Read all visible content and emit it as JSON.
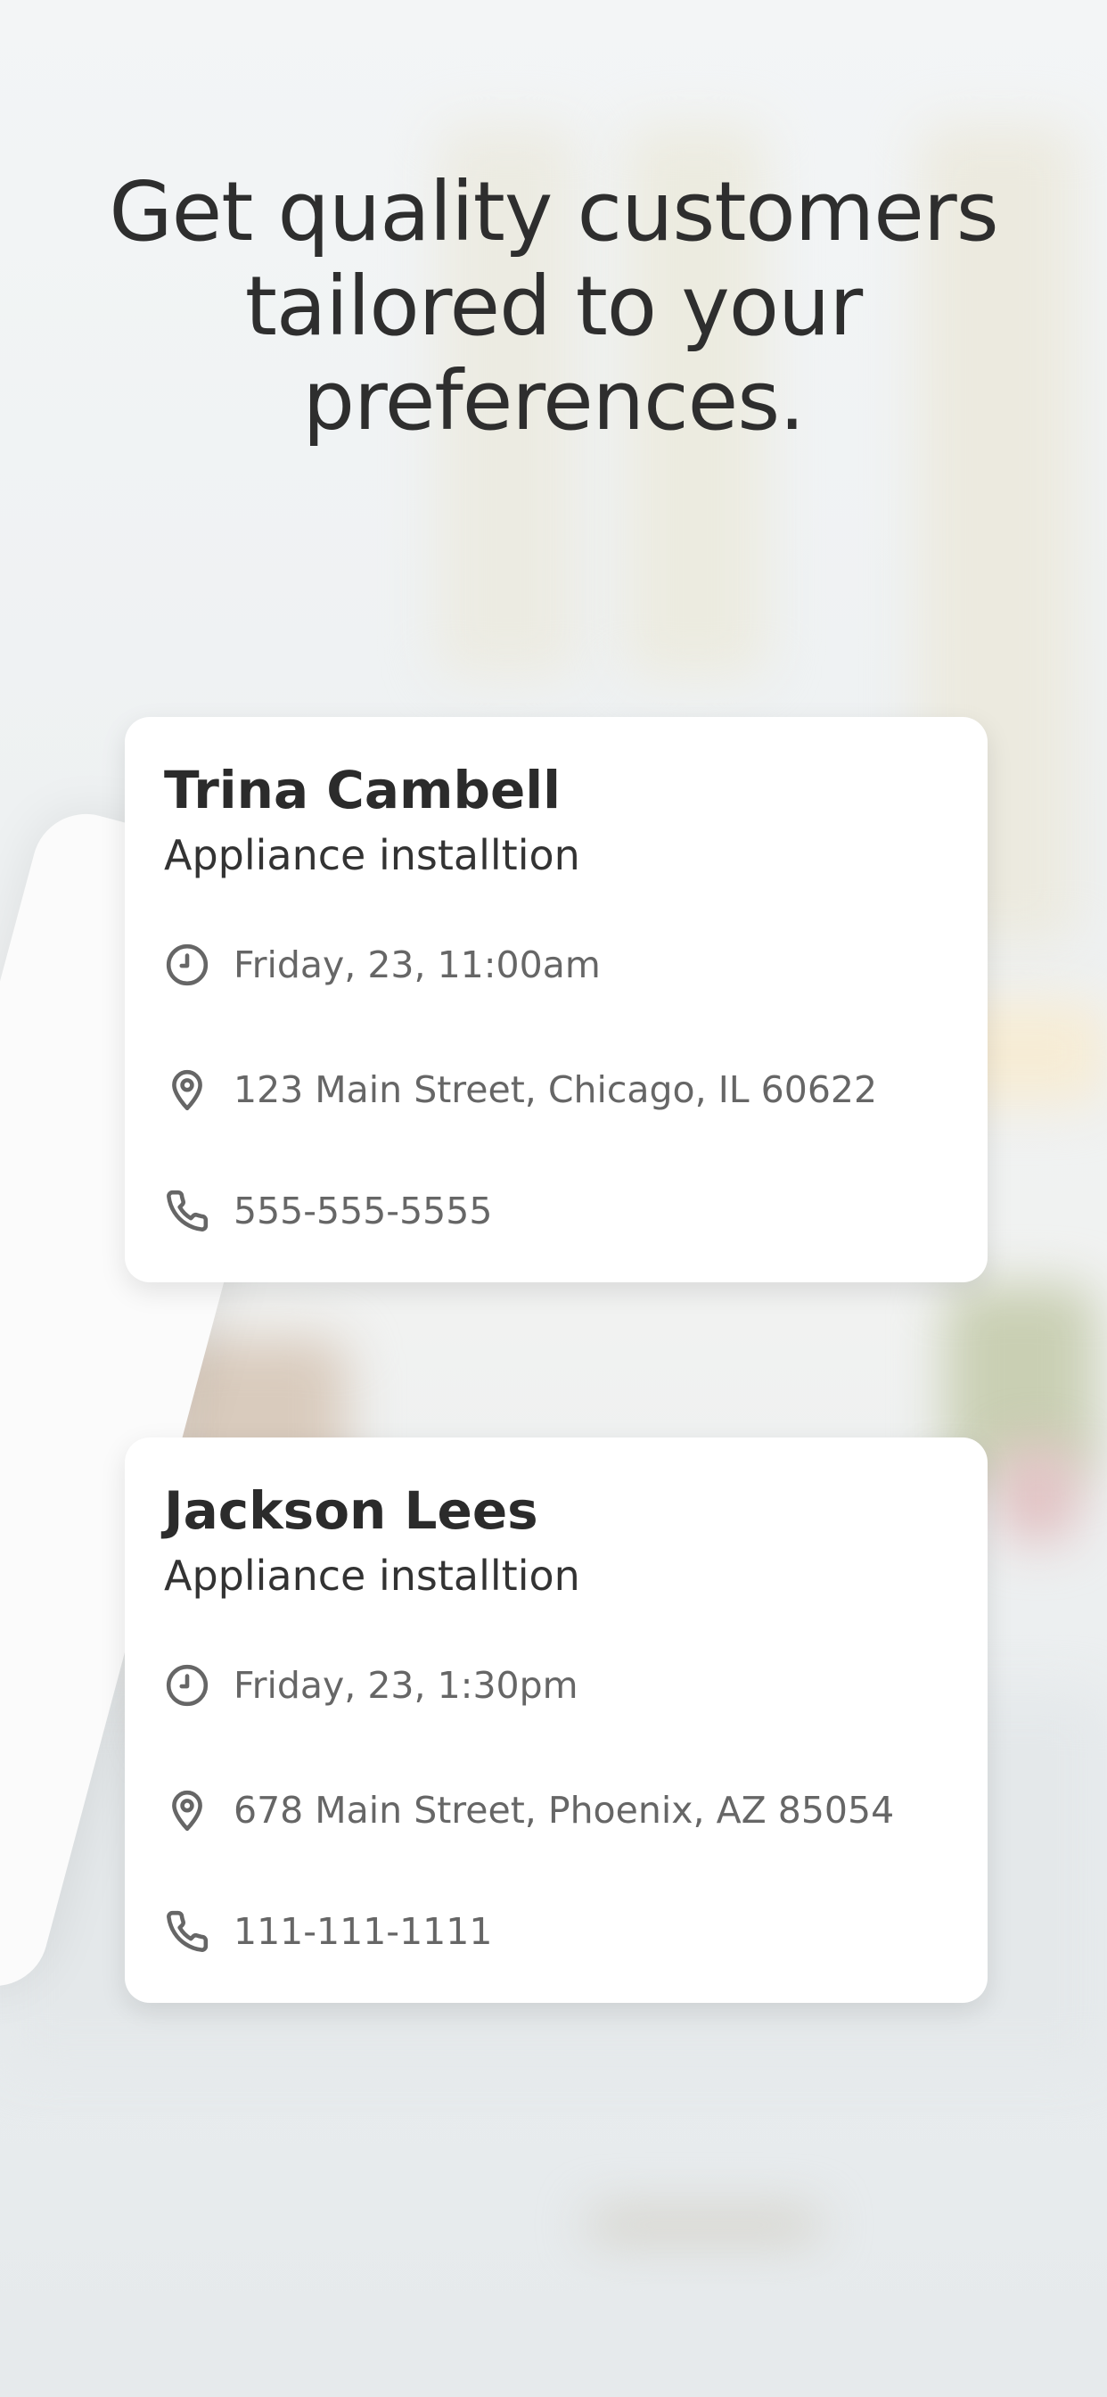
{
  "headline": "Get quality customers tailored to your preferences.",
  "colors": {
    "text": "#2e2e2e",
    "secondary_text": "#666666",
    "card_background": "#ffffff"
  },
  "cards": [
    {
      "name": "Trina Cambell",
      "service": "Appliance installtion",
      "time": "Friday, 23, 11:00am",
      "address": "123 Main Street, Chicago, IL 60622",
      "phone": "555-555-5555"
    },
    {
      "name": "Jackson Lees",
      "service": "Appliance installtion",
      "time": "Friday, 23, 1:30pm",
      "address": "678 Main Street, Phoenix, AZ 85054",
      "phone": "111-111-1111"
    }
  ],
  "icons": {
    "time": "clock-icon",
    "address": "location-pin-icon",
    "phone": "phone-icon"
  }
}
